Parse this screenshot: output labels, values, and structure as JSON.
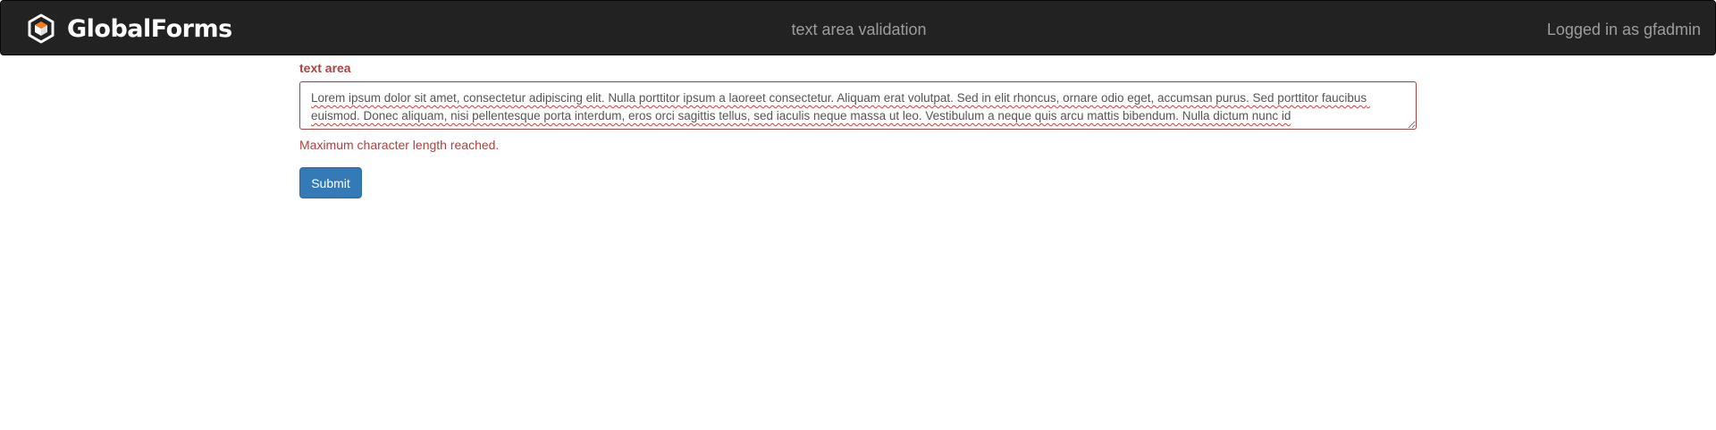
{
  "navbar": {
    "brand_name": "GlobalForms",
    "brand_icon": "hexagon-cube-logo-icon",
    "page_title": "text area validation",
    "user_text": "Logged in as gfadmin"
  },
  "form": {
    "textarea_label": "text area",
    "textarea_value": "Lorem ipsum dolor sit amet, consectetur adipiscing elit. Nulla porttitor ipsum a laoreet consectetur. Aliquam erat volutpat. Sed in elit rhoncus, ornare odio eget, accumsan purus. Sed porttitor faucibus euismod. Donec aliquam, nisi pellentesque porta interdum, eros orci sagittis tellus, sed iaculis neque massa ut leo. Vestibulum a neque quis arcu mattis bibendum. Nulla dictum nunc id",
    "error_message": "Maximum character length reached.",
    "submit_label": "Submit"
  },
  "colors": {
    "navbar_bg": "#222222",
    "navbar_text": "#9d9d9d",
    "brand_accent": "#f47c20",
    "error": "#a94442",
    "primary_button": "#337ab7"
  }
}
